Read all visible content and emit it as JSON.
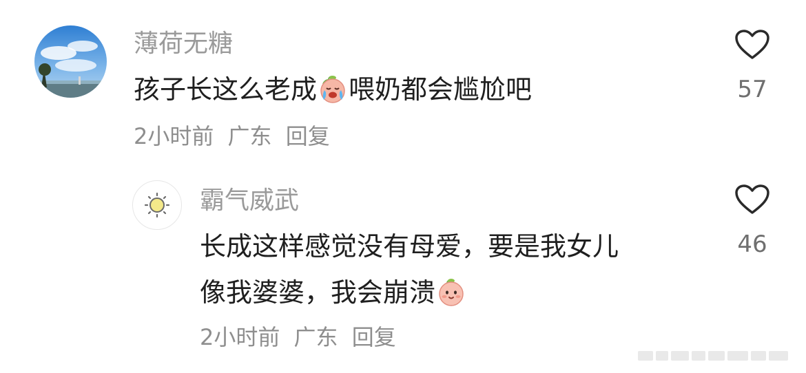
{
  "comments": [
    {
      "username": "薄荷无糖",
      "text_parts": [
        "孩子长这么老成",
        "喂奶都会尴尬吧"
      ],
      "emoji": "crying-face-emoji",
      "time": "2小时前",
      "location": "广东",
      "reply_label": "回复",
      "likes": "57",
      "avatar": "sky-landscape-avatar"
    },
    {
      "username": "霸气威武",
      "text_line1": "长成这样感觉没有母爱，要是我女儿",
      "text_line2": "像我婆婆，我会崩溃",
      "emoji": "smiling-face-emoji",
      "time": "2小时前",
      "location": "广东",
      "reply_label": "回复",
      "likes": "46",
      "avatar": "sun-icon-avatar"
    }
  ],
  "colors": {
    "username": "#9a9a9a",
    "text": "#1f1f1f",
    "meta": "#8e8e8e",
    "heart_outline": "#2a2a2a",
    "emoji_face": "#f6b7a6"
  }
}
